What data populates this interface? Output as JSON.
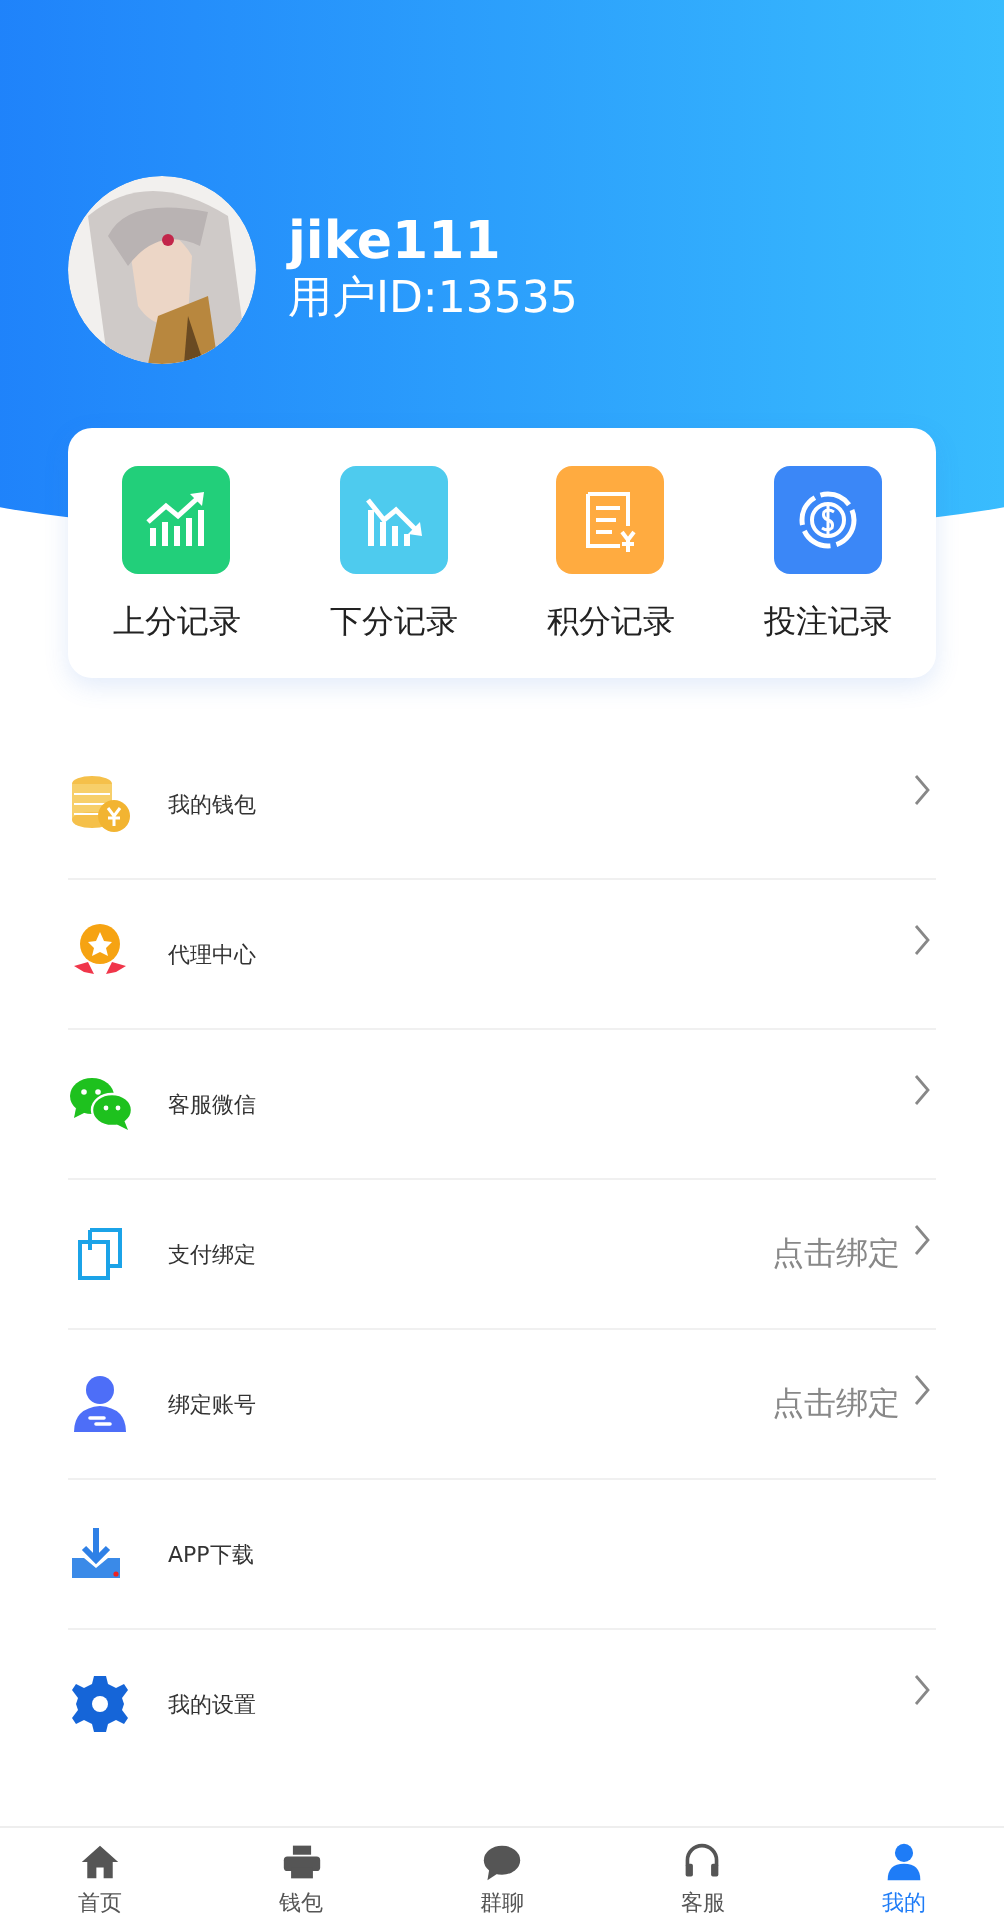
{
  "profile": {
    "username": "jike111",
    "user_id": "用户ID:13535"
  },
  "records": [
    {
      "label": "上分记录"
    },
    {
      "label": "下分记录"
    },
    {
      "label": "积分记录"
    },
    {
      "label": "投注记录"
    }
  ],
  "menu": [
    {
      "label": "我的钱包",
      "chevron": true
    },
    {
      "label": "代理中心",
      "chevron": true
    },
    {
      "label": "客服微信",
      "chevron": true
    },
    {
      "label": "支付绑定",
      "value": "点击绑定",
      "chevron": true
    },
    {
      "label": "绑定账号",
      "value": "点击绑定",
      "chevron": true
    },
    {
      "label": "APP下载",
      "chevron": false
    },
    {
      "label": "我的设置",
      "chevron": true
    }
  ],
  "tab_bar": [
    {
      "label": "首页",
      "selected": false
    },
    {
      "label": "钱包",
      "selected": false
    },
    {
      "label": "群聊",
      "selected": false
    },
    {
      "label": "客服",
      "selected": false
    },
    {
      "label": "我的",
      "selected": true
    }
  ]
}
